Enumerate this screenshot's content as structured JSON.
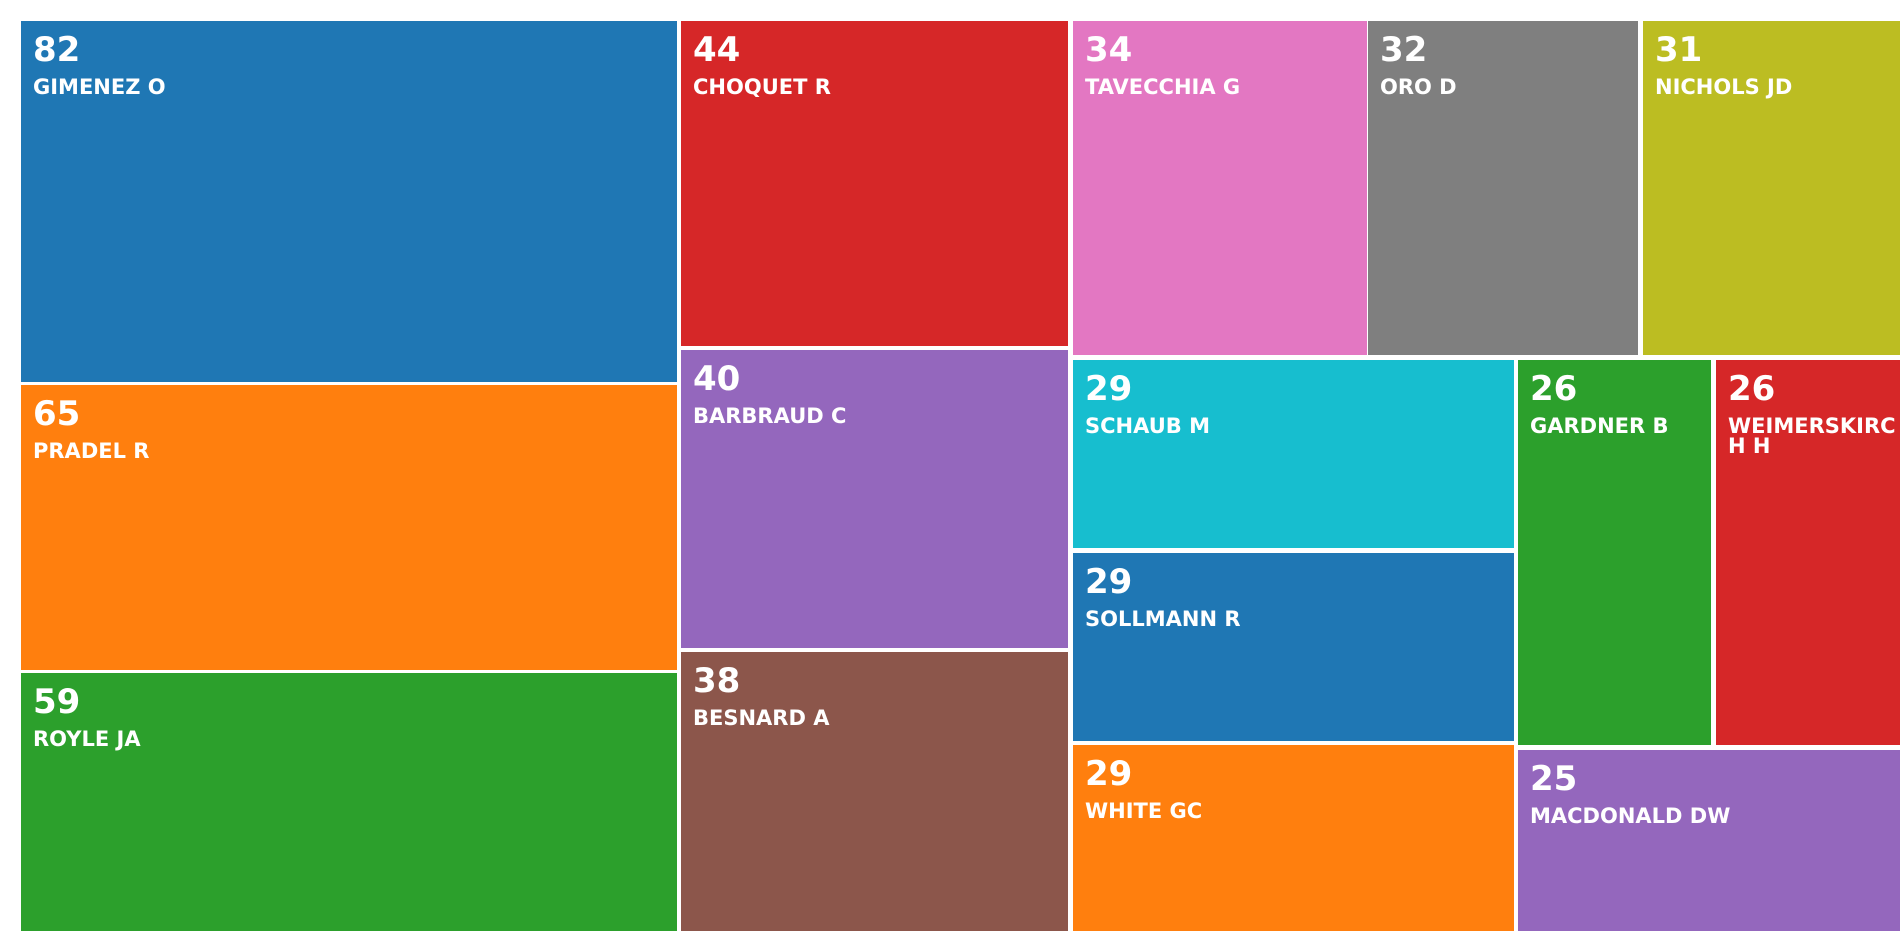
{
  "chart_data": {
    "type": "treemap",
    "items": [
      {
        "label": "GIMENEZ O",
        "value": 82,
        "color": "#1f77b4"
      },
      {
        "label": "PRADEL R",
        "value": 65,
        "color": "#ff7f0e"
      },
      {
        "label": "ROYLE JA",
        "value": 59,
        "color": "#2ca02c"
      },
      {
        "label": "CHOQUET R",
        "value": 44,
        "color": "#d62728"
      },
      {
        "label": "BARBRAUD C",
        "value": 40,
        "color": "#9467bd"
      },
      {
        "label": "BESNARD A",
        "value": 38,
        "color": "#8c564b"
      },
      {
        "label": "TAVECCHIA G",
        "value": 34,
        "color": "#e377c2"
      },
      {
        "label": "ORO D",
        "value": 32,
        "color": "#7f7f7f"
      },
      {
        "label": "NICHOLS JD",
        "value": 31,
        "color": "#bcbd22"
      },
      {
        "label": "SCHAUB M",
        "value": 29,
        "color": "#17becf"
      },
      {
        "label": "SOLLMANN R",
        "value": 29,
        "color": "#1f77b4"
      },
      {
        "label": "WHITE GC",
        "value": 29,
        "color": "#ff7f0e"
      },
      {
        "label": "GARDNER B",
        "value": 26,
        "color": "#2ca02c"
      },
      {
        "label": "WEIMERSKIRCH H",
        "value": 26,
        "color": "#d62728"
      },
      {
        "label": "MACDONALD DW",
        "value": 25,
        "color": "#9467bd"
      }
    ]
  }
}
